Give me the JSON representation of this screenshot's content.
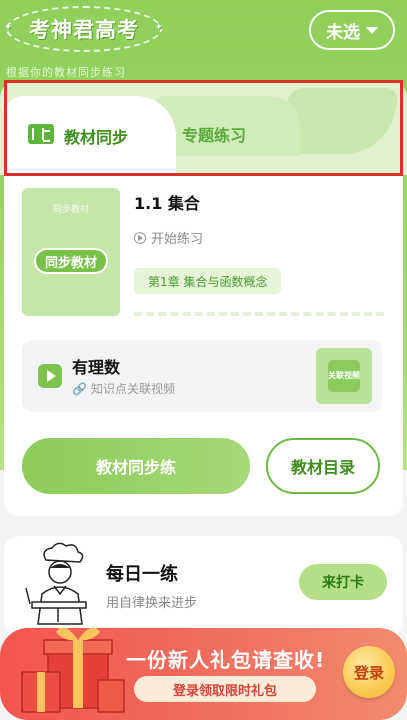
{
  "header": {
    "logo_text": "考神君高考",
    "select_label": "未选",
    "subtitle": "根据你的教材同步练习"
  },
  "tabs": [
    {
      "label": "教材同步",
      "active": true
    },
    {
      "label": "专题练习",
      "active": false
    }
  ],
  "textbook": {
    "cover_top": "同步教材",
    "cover_tag": "同步教材",
    "lesson_title": "1.1 集合",
    "start_label": "开始练习",
    "chapter": "第1章 集合与函数概念"
  },
  "knowledge": {
    "title": "有理数",
    "subtitle": "知识点关联视频",
    "thumb_label": "关联视频"
  },
  "actions": {
    "primary": "教材同步练",
    "secondary": "教材目录"
  },
  "daily": {
    "title": "每日一练",
    "subtitle": "用自律换来进步",
    "button": "来打卡"
  },
  "banner": {
    "title": "一份新人礼包请查收!",
    "subtitle": "登录领取限时礼包",
    "login": "登录"
  },
  "colors": {
    "accent_green": "#8fcf5a",
    "highlight_red": "#d9302c",
    "banner_red": "#f2554f"
  }
}
